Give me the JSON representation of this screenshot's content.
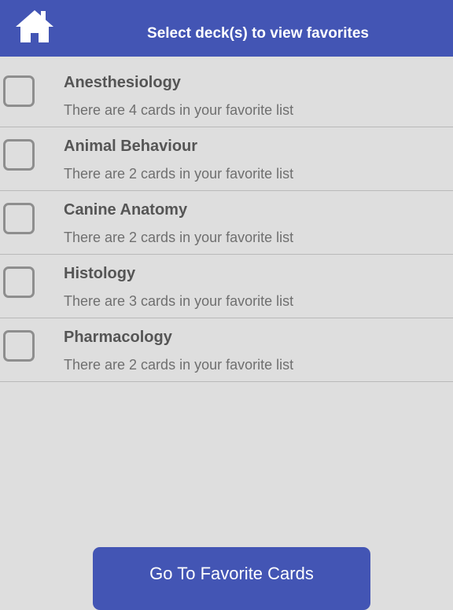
{
  "header": {
    "title": "Select deck(s) to view favorites",
    "home_icon": "home-icon",
    "background_color": "#4355b4"
  },
  "decks": [
    {
      "name": "Anesthesiology",
      "description": "There are 4 cards in your favorite list",
      "checked": false
    },
    {
      "name": "Animal Behaviour",
      "description": "There are 2 cards in your favorite list",
      "checked": false
    },
    {
      "name": "Canine Anatomy",
      "description": "There are 2 cards in your favorite list",
      "checked": false
    },
    {
      "name": "Histology",
      "description": "There are 3 cards in your favorite list",
      "checked": false
    },
    {
      "name": "Pharmacology",
      "description": "There are 2 cards in your favorite list",
      "checked": false
    }
  ],
  "footer": {
    "button_label": "Go To Favorite Cards",
    "button_color": "#4355b4"
  },
  "colors": {
    "page_background": "#dedede",
    "divider": "#b9b9b9"
  }
}
